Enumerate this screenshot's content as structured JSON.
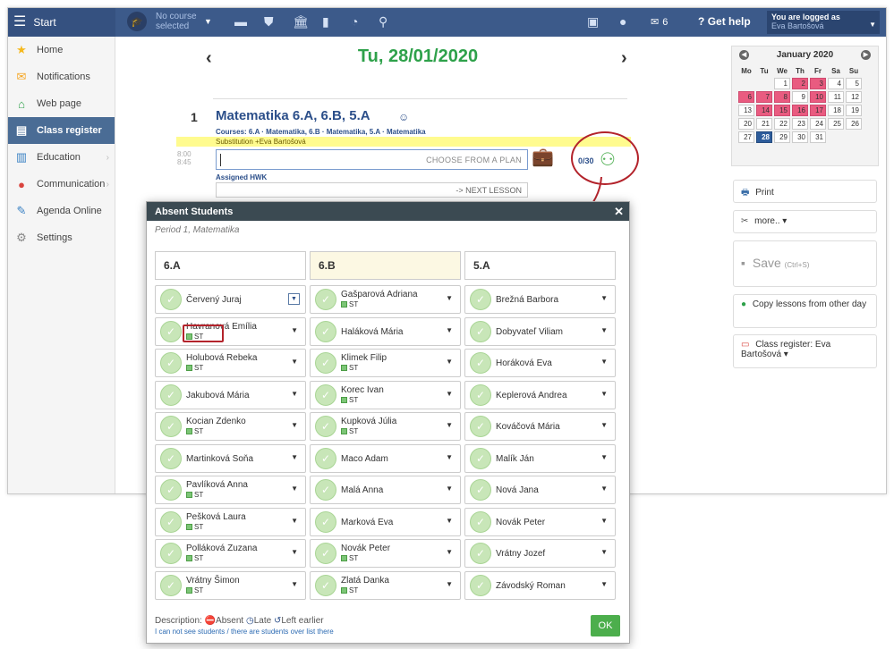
{
  "topbar": {
    "start_label": "Start",
    "course_line1": "No course",
    "course_line2": "selected",
    "messages_count": "6",
    "help_label": "Get help",
    "logged_label": "You are logged as",
    "logged_user": "Eva Bartošová"
  },
  "sidebar": {
    "items": [
      {
        "label": "Home",
        "icon": "star-icon"
      },
      {
        "label": "Notifications",
        "icon": "envelope-icon"
      },
      {
        "label": "Web page",
        "icon": "house-icon"
      },
      {
        "label": "Class register",
        "icon": "register-icon"
      },
      {
        "label": "Education",
        "icon": "book-icon"
      },
      {
        "label": "Communication",
        "icon": "chat-icon"
      },
      {
        "label": "Agenda Online",
        "icon": "pen-icon"
      },
      {
        "label": "Settings",
        "icon": "gear-icon"
      }
    ]
  },
  "date": {
    "title": "Tu, 28/01/2020"
  },
  "lesson": {
    "number": "1",
    "title": "Matematika  6.A, 6.B, 5.A",
    "courses": "Courses:  6.A · Matematika, 6.B · Matematika, 5.A · Matematika",
    "substitution": "Substitution  +Eva Bartošová",
    "time_start": "8:00",
    "time_end": "8:45",
    "plan_button": "CHOOSE FROM A PLAN",
    "absent_count": "0/30",
    "hwk_label": "Assigned HWK",
    "next_lesson": "-> NEXT LESSON"
  },
  "calendar": {
    "month": "January 2020",
    "weekdays": [
      "Mo",
      "Tu",
      "We",
      "Th",
      "Fr",
      "Sa",
      "Su"
    ],
    "rows": [
      [
        "",
        "",
        "1",
        "2",
        "3",
        "4",
        "5"
      ],
      [
        "6",
        "7",
        "8",
        "9",
        "10",
        "11",
        "12"
      ],
      [
        "13",
        "14",
        "15",
        "16",
        "17",
        "18",
        "19"
      ],
      [
        "20",
        "21",
        "22",
        "23",
        "24",
        "25",
        "26"
      ],
      [
        "27",
        "28",
        "29",
        "30",
        "31",
        "",
        ""
      ]
    ]
  },
  "right_buttons": {
    "print": "Print",
    "more": "more.. ▾",
    "save": "Save",
    "save_shortcut": "(Ctrl+S)",
    "copy": "Copy lessons from other day",
    "class_register": "Class register: Eva Bartošová ▾"
  },
  "modal": {
    "title": "Absent Students",
    "subtitle": "Period 1, Matematika",
    "st_tag": "ST",
    "columns": [
      {
        "name": "6.A",
        "students": [
          {
            "name": "Červený Juraj",
            "st": false
          },
          {
            "name": "Havranová Emília",
            "st": true
          },
          {
            "name": "Holubová Rebeka",
            "st": true
          },
          {
            "name": "Jakubová Mária",
            "st": false
          },
          {
            "name": "Kocian Zdenko",
            "st": true
          },
          {
            "name": "Martinková Soňa",
            "st": false
          },
          {
            "name": "Pavlíková Anna",
            "st": true
          },
          {
            "name": "Pešková Laura",
            "st": true
          },
          {
            "name": "Polláková Zuzana",
            "st": true
          },
          {
            "name": "Vrátny Šimon",
            "st": true
          }
        ]
      },
      {
        "name": "6.B",
        "students": [
          {
            "name": "Gašparová Adriana",
            "st": true
          },
          {
            "name": "Haláková Mária",
            "st": false
          },
          {
            "name": "Klimek Filip",
            "st": true
          },
          {
            "name": "Korec Ivan",
            "st": true
          },
          {
            "name": "Kupková Júlia",
            "st": true
          },
          {
            "name": "Maco Adam",
            "st": false
          },
          {
            "name": "Malá Anna",
            "st": false
          },
          {
            "name": "Marková Eva",
            "st": false
          },
          {
            "name": "Novák Peter",
            "st": true
          },
          {
            "name": "Zlatá Danka",
            "st": true
          }
        ]
      },
      {
        "name": "5.A",
        "students": [
          {
            "name": "Brežná Barbora",
            "st": false
          },
          {
            "name": "Dobyvateľ Viliam",
            "st": false
          },
          {
            "name": "Horáková Eva",
            "st": false
          },
          {
            "name": "Keplerová Andrea",
            "st": false
          },
          {
            "name": "Kováčová Mária",
            "st": false
          },
          {
            "name": "Malík Ján",
            "st": false
          },
          {
            "name": "Nová Jana",
            "st": false
          },
          {
            "name": "Novák Peter",
            "st": false
          },
          {
            "name": "Vrátny Jozef",
            "st": false
          },
          {
            "name": "Závodský Roman",
            "st": false
          }
        ]
      }
    ],
    "legend_prefix": "Description:",
    "legend_absent": "Absent",
    "legend_late": "Late",
    "legend_left": "Left earlier",
    "note": "I can not see students / there are students over list there",
    "ok": "OK"
  },
  "colors": {
    "topbar": "#3c5a8a",
    "sidebar_active": "#4a6c95",
    "date_green": "#2ea14a",
    "highlight_red": "#b3232b",
    "calendar_red": "#e95b80",
    "calendar_today": "#2d5c9b",
    "ok_green": "#4cae4c"
  }
}
